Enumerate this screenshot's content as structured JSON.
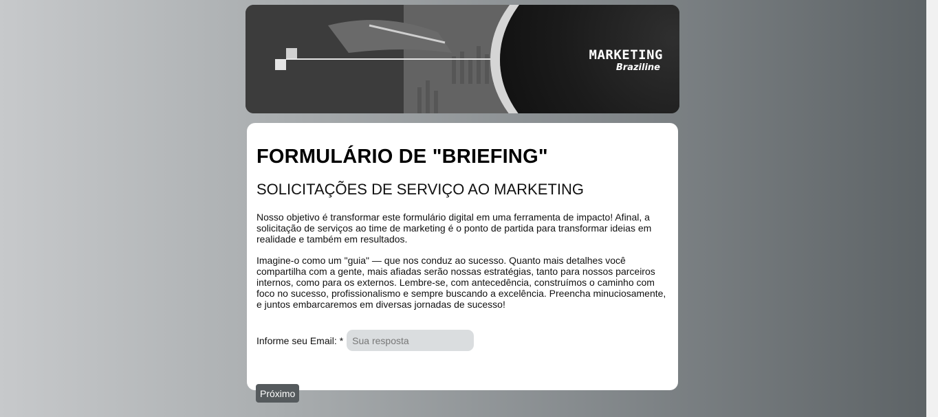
{
  "banner": {
    "brand_main": "MARKETING",
    "brand_sub": "Braziline"
  },
  "form": {
    "title": "FORMULÁRIO DE \"BRIEFING\"",
    "subtitle": "SOLICITAÇÕES DE SERVIÇO AO MARKETING",
    "paragraph1": "Nosso objetivo é transformar este formulário digital em uma ferramenta de impacto! Afinal, a solicitação de serviços ao time de marketing é o ponto de partida para transformar ideias em realidade e também em resultados.",
    "paragraph2": "Imagine-o como um \"guia\" — que nos conduz ao sucesso. Quanto mais detalhes você compartilha com a gente, mais afiadas serão nossas estratégias, tanto para nossos parceiros internos, como para os externos. Lembre-se, com antecedência, construímos o caminho com foco no sucesso, profissionalismo e sempre buscando a excelência. Preencha minuciosamente, e juntos embarcaremos em diversas jornadas de sucesso!",
    "email_label": "Informe seu Email:",
    "required_mark": "*",
    "email_value": "",
    "email_placeholder": "Sua resposta",
    "next_label": "Próximo"
  },
  "colors": {
    "button_bg": "#555a5d",
    "input_bg": "#dadddf",
    "card_bg": "#ffffff"
  }
}
